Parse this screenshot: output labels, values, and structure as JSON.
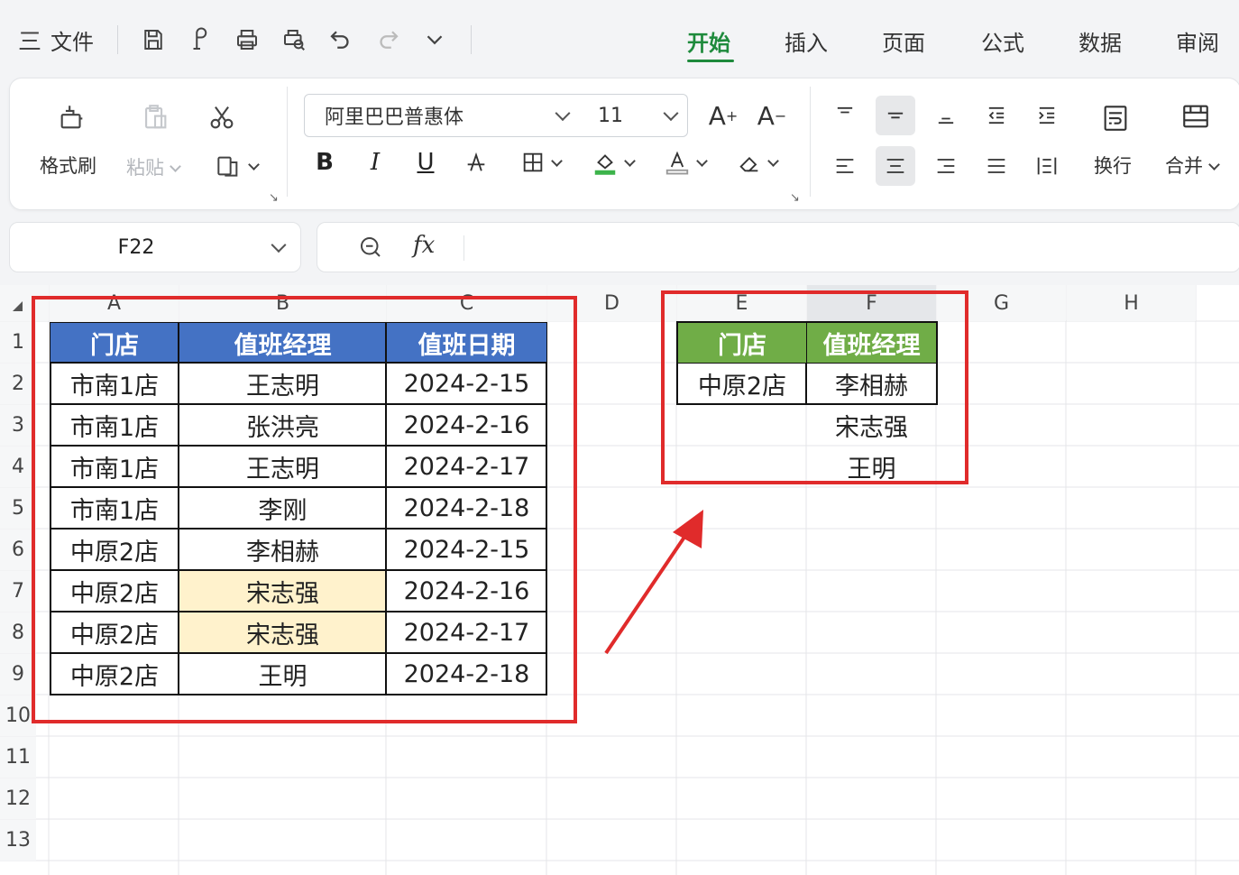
{
  "menu": {
    "hamburger": "三",
    "file": "文件"
  },
  "tabs": [
    {
      "label": "开始",
      "active": true
    },
    {
      "label": "插入",
      "active": false
    },
    {
      "label": "页面",
      "active": false
    },
    {
      "label": "公式",
      "active": false
    },
    {
      "label": "数据",
      "active": false
    },
    {
      "label": "审阅",
      "active": false
    }
  ],
  "ribbon": {
    "format_painter": "格式刷",
    "paste": "粘贴",
    "font_name": "阿里巴巴普惠体",
    "font_size": "11",
    "bold": "B",
    "italic": "I",
    "underline": "U",
    "wrap": "换行",
    "merge": "合并"
  },
  "formula_bar": {
    "cell_ref": "F22",
    "fx": "fx",
    "content": ""
  },
  "columns": [
    "A",
    "B",
    "C",
    "D",
    "E",
    "F",
    "G",
    "H"
  ],
  "rows": [
    "1",
    "2",
    "3",
    "4",
    "5",
    "6",
    "7",
    "8",
    "9",
    "10",
    "11",
    "12",
    "13"
  ],
  "table1": {
    "headers": [
      "门店",
      "值班经理",
      "值班日期"
    ],
    "rows": [
      [
        "市南1店",
        "王志明",
        "2024-2-15"
      ],
      [
        "市南1店",
        "张洪亮",
        "2024-2-16"
      ],
      [
        "市南1店",
        "王志明",
        "2024-2-17"
      ],
      [
        "市南1店",
        "李刚",
        "2024-2-18"
      ],
      [
        "中原2店",
        "李相赫",
        "2024-2-15"
      ],
      [
        "中原2店",
        "宋志强",
        "2024-2-16"
      ],
      [
        "中原2店",
        "宋志强",
        "2024-2-17"
      ],
      [
        "中原2店",
        "王明",
        "2024-2-18"
      ]
    ],
    "highlighted_rows": [
      5,
      6
    ],
    "header_color": "#4472c4",
    "highlight_color": "#fff2cc"
  },
  "table2": {
    "headers": [
      "门店",
      "值班经理"
    ],
    "store": "中原2店",
    "managers": [
      "李相赫",
      "宋志强",
      "王明"
    ],
    "header_color": "#70ad47"
  },
  "annotation_color": "#e02b2b"
}
